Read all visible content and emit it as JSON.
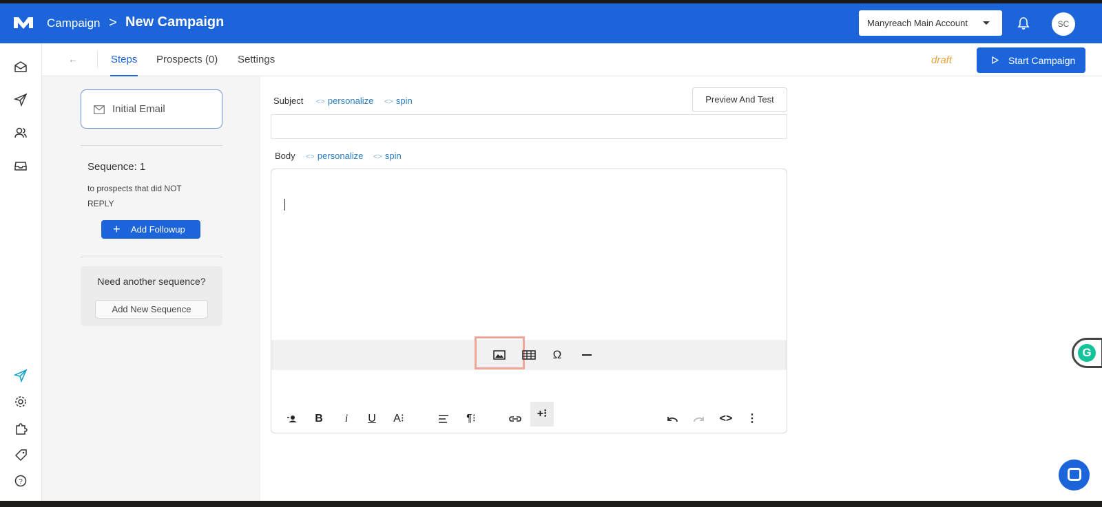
{
  "header": {
    "breadcrumb_root": "Campaign",
    "breadcrumb_sep": ">",
    "page_title": "New Campaign",
    "account_selector": "Manyreach Main Account",
    "avatar_initials": "SC"
  },
  "leftnav": {
    "items": [
      "mail-icon",
      "send-icon",
      "users-icon",
      "inbox-icon",
      "send-active-icon",
      "gear-icon",
      "puzzle-icon",
      "tag-icon",
      "help-icon"
    ]
  },
  "subnav": {
    "back_label": "←",
    "tabs": [
      {
        "label": "Steps",
        "active": true
      },
      {
        "label": "Prospects (0)",
        "active": false
      },
      {
        "label": "Settings",
        "active": false
      }
    ],
    "status": "draft",
    "start_button": "Start Campaign"
  },
  "sequence_panel": {
    "step_label": "Initial Email",
    "sequence_title": "Sequence: 1",
    "sequence_desc": "to prospects that did NOT REPLY",
    "add_followup": "Add Followup",
    "need_another": "Need another sequence?",
    "add_sequence": "Add New Sequence"
  },
  "editor": {
    "subject_label": "Subject",
    "body_label": "Body",
    "personalize": "personalize",
    "spin": "spin",
    "token_brackets": "<>",
    "preview_button": "Preview And Test",
    "subject_value": "",
    "insert_toolbar": [
      "image-icon",
      "table-icon",
      "special-char-icon",
      "horizontal-line-icon"
    ],
    "format_toolbar": [
      "personalize-icon",
      "bold-icon",
      "italic-icon",
      "underline-icon",
      "font-size-icon",
      "align-icon",
      "paragraph-icon",
      "link-icon",
      "insert-more-icon",
      "undo-icon",
      "redo-icon",
      "code-view-icon",
      "more-icon"
    ],
    "glyphs": {
      "bold": "B",
      "italic": "i",
      "underline": "U",
      "font_size": "A⁝",
      "paragraph": "¶⁝",
      "insert_more": "+⁝",
      "special_char": "Ω",
      "more": "⋮",
      "code": "<>"
    }
  },
  "colors": {
    "brand": "#1b64da",
    "draft": "#e8a33d",
    "highlight": "#f0a79a"
  }
}
